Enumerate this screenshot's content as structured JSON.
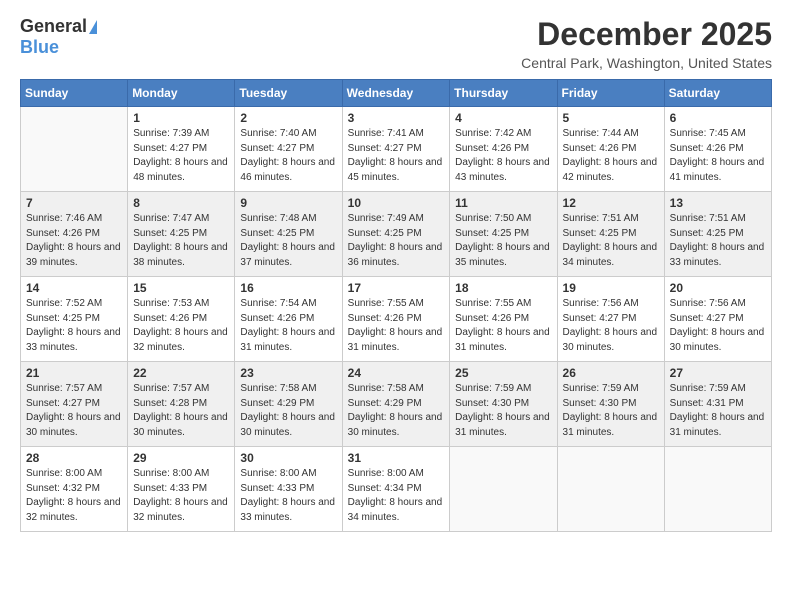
{
  "logo": {
    "general": "General",
    "blue": "Blue"
  },
  "title": {
    "month": "December 2025",
    "location": "Central Park, Washington, United States"
  },
  "headers": [
    "Sunday",
    "Monday",
    "Tuesday",
    "Wednesday",
    "Thursday",
    "Friday",
    "Saturday"
  ],
  "weeks": [
    [
      {
        "day": "",
        "empty": true
      },
      {
        "day": "1",
        "sunrise": "Sunrise: 7:39 AM",
        "sunset": "Sunset: 4:27 PM",
        "daylight": "Daylight: 8 hours and 48 minutes."
      },
      {
        "day": "2",
        "sunrise": "Sunrise: 7:40 AM",
        "sunset": "Sunset: 4:27 PM",
        "daylight": "Daylight: 8 hours and 46 minutes."
      },
      {
        "day": "3",
        "sunrise": "Sunrise: 7:41 AM",
        "sunset": "Sunset: 4:27 PM",
        "daylight": "Daylight: 8 hours and 45 minutes."
      },
      {
        "day": "4",
        "sunrise": "Sunrise: 7:42 AM",
        "sunset": "Sunset: 4:26 PM",
        "daylight": "Daylight: 8 hours and 43 minutes."
      },
      {
        "day": "5",
        "sunrise": "Sunrise: 7:44 AM",
        "sunset": "Sunset: 4:26 PM",
        "daylight": "Daylight: 8 hours and 42 minutes."
      },
      {
        "day": "6",
        "sunrise": "Sunrise: 7:45 AM",
        "sunset": "Sunset: 4:26 PM",
        "daylight": "Daylight: 8 hours and 41 minutes."
      }
    ],
    [
      {
        "day": "7",
        "sunrise": "Sunrise: 7:46 AM",
        "sunset": "Sunset: 4:26 PM",
        "daylight": "Daylight: 8 hours and 39 minutes."
      },
      {
        "day": "8",
        "sunrise": "Sunrise: 7:47 AM",
        "sunset": "Sunset: 4:25 PM",
        "daylight": "Daylight: 8 hours and 38 minutes."
      },
      {
        "day": "9",
        "sunrise": "Sunrise: 7:48 AM",
        "sunset": "Sunset: 4:25 PM",
        "daylight": "Daylight: 8 hours and 37 minutes."
      },
      {
        "day": "10",
        "sunrise": "Sunrise: 7:49 AM",
        "sunset": "Sunset: 4:25 PM",
        "daylight": "Daylight: 8 hours and 36 minutes."
      },
      {
        "day": "11",
        "sunrise": "Sunrise: 7:50 AM",
        "sunset": "Sunset: 4:25 PM",
        "daylight": "Daylight: 8 hours and 35 minutes."
      },
      {
        "day": "12",
        "sunrise": "Sunrise: 7:51 AM",
        "sunset": "Sunset: 4:25 PM",
        "daylight": "Daylight: 8 hours and 34 minutes."
      },
      {
        "day": "13",
        "sunrise": "Sunrise: 7:51 AM",
        "sunset": "Sunset: 4:25 PM",
        "daylight": "Daylight: 8 hours and 33 minutes."
      }
    ],
    [
      {
        "day": "14",
        "sunrise": "Sunrise: 7:52 AM",
        "sunset": "Sunset: 4:25 PM",
        "daylight": "Daylight: 8 hours and 33 minutes."
      },
      {
        "day": "15",
        "sunrise": "Sunrise: 7:53 AM",
        "sunset": "Sunset: 4:26 PM",
        "daylight": "Daylight: 8 hours and 32 minutes."
      },
      {
        "day": "16",
        "sunrise": "Sunrise: 7:54 AM",
        "sunset": "Sunset: 4:26 PM",
        "daylight": "Daylight: 8 hours and 31 minutes."
      },
      {
        "day": "17",
        "sunrise": "Sunrise: 7:55 AM",
        "sunset": "Sunset: 4:26 PM",
        "daylight": "Daylight: 8 hours and 31 minutes."
      },
      {
        "day": "18",
        "sunrise": "Sunrise: 7:55 AM",
        "sunset": "Sunset: 4:26 PM",
        "daylight": "Daylight: 8 hours and 31 minutes."
      },
      {
        "day": "19",
        "sunrise": "Sunrise: 7:56 AM",
        "sunset": "Sunset: 4:27 PM",
        "daylight": "Daylight: 8 hours and 30 minutes."
      },
      {
        "day": "20",
        "sunrise": "Sunrise: 7:56 AM",
        "sunset": "Sunset: 4:27 PM",
        "daylight": "Daylight: 8 hours and 30 minutes."
      }
    ],
    [
      {
        "day": "21",
        "sunrise": "Sunrise: 7:57 AM",
        "sunset": "Sunset: 4:27 PM",
        "daylight": "Daylight: 8 hours and 30 minutes."
      },
      {
        "day": "22",
        "sunrise": "Sunrise: 7:57 AM",
        "sunset": "Sunset: 4:28 PM",
        "daylight": "Daylight: 8 hours and 30 minutes."
      },
      {
        "day": "23",
        "sunrise": "Sunrise: 7:58 AM",
        "sunset": "Sunset: 4:29 PM",
        "daylight": "Daylight: 8 hours and 30 minutes."
      },
      {
        "day": "24",
        "sunrise": "Sunrise: 7:58 AM",
        "sunset": "Sunset: 4:29 PM",
        "daylight": "Daylight: 8 hours and 30 minutes."
      },
      {
        "day": "25",
        "sunrise": "Sunrise: 7:59 AM",
        "sunset": "Sunset: 4:30 PM",
        "daylight": "Daylight: 8 hours and 31 minutes."
      },
      {
        "day": "26",
        "sunrise": "Sunrise: 7:59 AM",
        "sunset": "Sunset: 4:30 PM",
        "daylight": "Daylight: 8 hours and 31 minutes."
      },
      {
        "day": "27",
        "sunrise": "Sunrise: 7:59 AM",
        "sunset": "Sunset: 4:31 PM",
        "daylight": "Daylight: 8 hours and 31 minutes."
      }
    ],
    [
      {
        "day": "28",
        "sunrise": "Sunrise: 8:00 AM",
        "sunset": "Sunset: 4:32 PM",
        "daylight": "Daylight: 8 hours and 32 minutes."
      },
      {
        "day": "29",
        "sunrise": "Sunrise: 8:00 AM",
        "sunset": "Sunset: 4:33 PM",
        "daylight": "Daylight: 8 hours and 32 minutes."
      },
      {
        "day": "30",
        "sunrise": "Sunrise: 8:00 AM",
        "sunset": "Sunset: 4:33 PM",
        "daylight": "Daylight: 8 hours and 33 minutes."
      },
      {
        "day": "31",
        "sunrise": "Sunrise: 8:00 AM",
        "sunset": "Sunset: 4:34 PM",
        "daylight": "Daylight: 8 hours and 34 minutes."
      },
      {
        "day": "",
        "empty": true
      },
      {
        "day": "",
        "empty": true
      },
      {
        "day": "",
        "empty": true
      }
    ]
  ]
}
